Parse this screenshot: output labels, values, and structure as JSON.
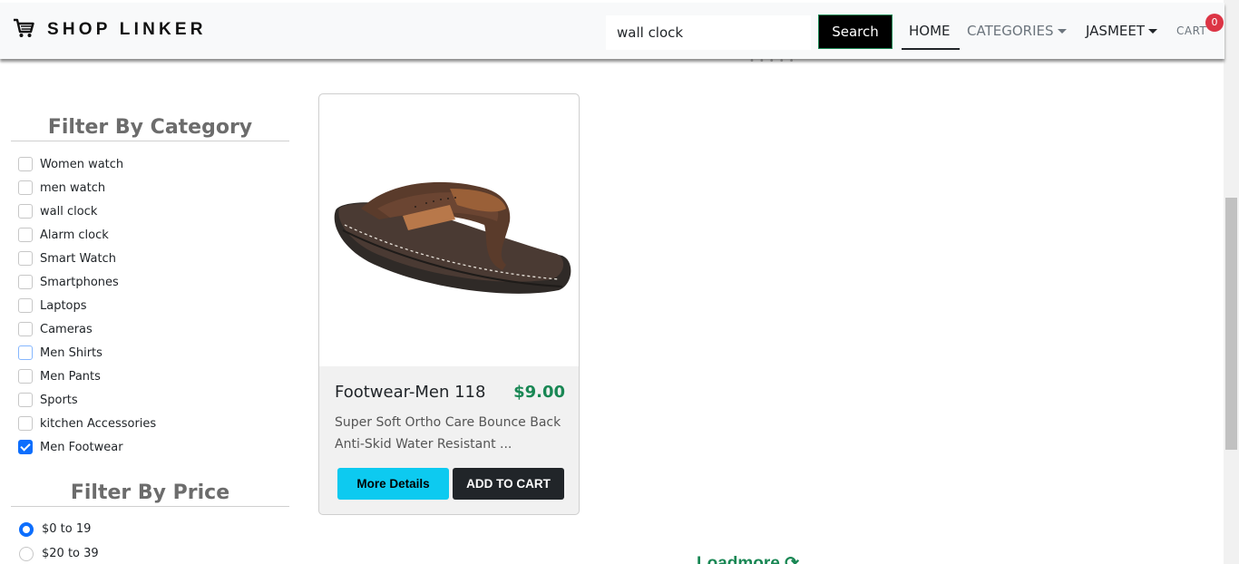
{
  "navbar": {
    "brand": "SHOP LINKER",
    "brand_icon": "shopping-cart-icon",
    "search_value": "wall clock",
    "search_button": "Search",
    "links": {
      "home": "HOME",
      "categories": "CATEGORIES",
      "user": "JASMEET",
      "cart": "CART"
    },
    "cart_count": "0"
  },
  "sidebar": {
    "category_title": "Filter By Category",
    "categories": [
      {
        "label": "Women watch",
        "checked": false
      },
      {
        "label": "men watch",
        "checked": false
      },
      {
        "label": "wall clock",
        "checked": false
      },
      {
        "label": "Alarm clock",
        "checked": false
      },
      {
        "label": "Smart Watch",
        "checked": false
      },
      {
        "label": "Smartphones",
        "checked": false
      },
      {
        "label": "Laptops",
        "checked": false
      },
      {
        "label": "Cameras",
        "checked": false
      },
      {
        "label": "Men Shirts",
        "checked": false
      },
      {
        "label": "Men Pants",
        "checked": false
      },
      {
        "label": "Sports",
        "checked": false
      },
      {
        "label": "kitchen Accessories",
        "checked": false
      },
      {
        "label": "Men Footwear",
        "checked": true
      }
    ],
    "price_title": "Filter By Price",
    "prices": [
      {
        "label": "$0 to 19",
        "checked": true
      },
      {
        "label": "$20 to 39",
        "checked": false
      }
    ]
  },
  "product": {
    "name": "Footwear-Men 118",
    "price": "$9.00",
    "description": "Super Soft Ortho Care Bounce Back Anti-Skid Water Resistant ...",
    "details_button": "More Details",
    "cart_button": "ADD TO CART"
  },
  "loadmore": "Loadmore",
  "colors": {
    "accent_green": "#198754",
    "info": "#0dcaf0",
    "dark": "#212529",
    "badge": "#dc3545",
    "primary": "#0d6efd"
  }
}
